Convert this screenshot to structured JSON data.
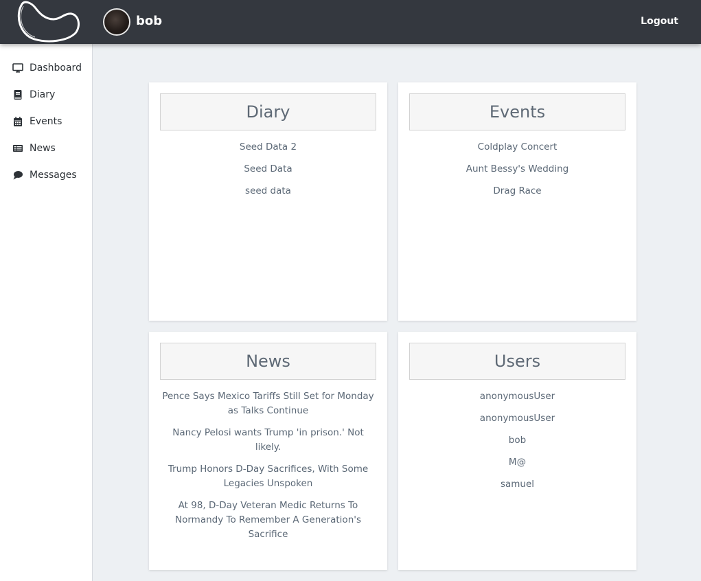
{
  "header": {
    "username": "bob",
    "logout_label": "Logout"
  },
  "sidebar": {
    "items": [
      {
        "label": "Dashboard",
        "icon": "monitor-icon"
      },
      {
        "label": "Diary",
        "icon": "book-icon"
      },
      {
        "label": "Events",
        "icon": "calendar-icon"
      },
      {
        "label": "News",
        "icon": "newspaper-icon"
      },
      {
        "label": "Messages",
        "icon": "comment-icon"
      }
    ]
  },
  "cards": {
    "diary": {
      "title": "Diary",
      "items": [
        "Seed Data 2",
        "Seed Data",
        "seed data"
      ]
    },
    "events": {
      "title": "Events",
      "items": [
        "Coldplay Concert",
        "Aunt Bessy's Wedding",
        "Drag Race"
      ]
    },
    "news": {
      "title": "News",
      "items": [
        "Pence Says Mexico Tariffs Still Set for Monday as Talks Continue",
        "Nancy Pelosi wants Trump 'in prison.' Not likely.",
        "Trump Honors D-Day Sacrifices, With Some Legacies Unspoken",
        "At 98, D-Day Veteran Medic Returns To Normandy To Remember A Generation's Sacrifice"
      ]
    },
    "users": {
      "title": "Users",
      "items": [
        "anonymousUser",
        "anonymousUser",
        "bob",
        "M@",
        "samuel"
      ]
    }
  },
  "colors": {
    "topbar": "#34383f",
    "page_background": "#edf0f3",
    "card_text": "#5b6876",
    "card_header_bg": "#f6f6f6"
  }
}
